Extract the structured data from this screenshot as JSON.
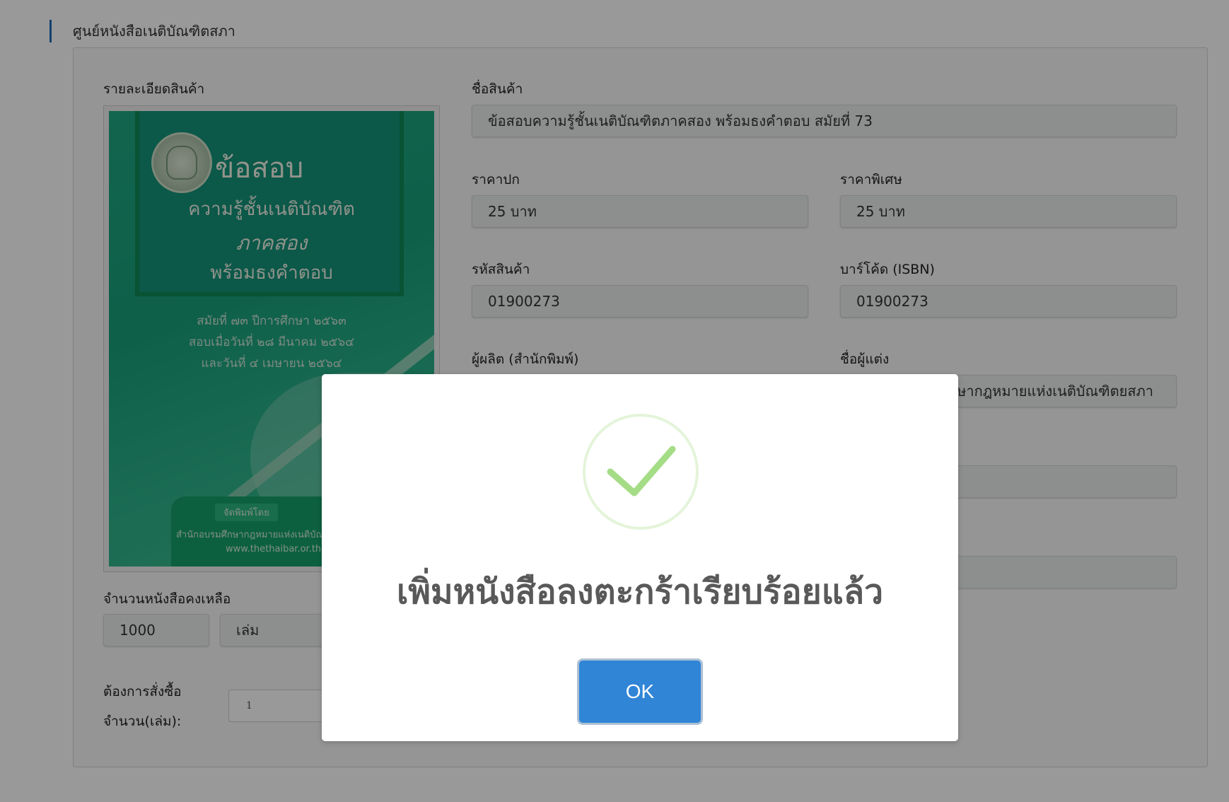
{
  "section": {
    "title": "ศูนย์หนังสือเนติบัณฑิตสภา"
  },
  "product": {
    "details_label": "รายละเอียดสินค้า",
    "name_label": "ชื่อสินค้า",
    "name_value": "ข้อสอบความรู้ชั้นเนติบัณฑิตภาคสอง พร้อมธงคำตอบ สมัยที่ 73",
    "cover_price_label": "ราคาปก",
    "cover_price_value": "25 บาท",
    "special_price_label": "ราคาพิเศษ",
    "special_price_value": "25 บาท",
    "code_label": "รหัสสินค้า",
    "code_value": "01900273",
    "barcode_label": "บาร์โค้ด (ISBN)",
    "barcode_value": "01900273",
    "publisher_label": "ผู้ผลิต (สำนักพิมพ์)",
    "author_label": "ชื่อผู้แต่ง",
    "author_value": "สำนักอบรมศึกษากฎหมายแห่งเนติบัณฑิตยสภา",
    "stock_label": "จำนวนหนังสือคงเหลือ",
    "stock_value": "1000",
    "stock_unit": "เล่ม",
    "order_label_1": "ต้องการสั่งซื้อ",
    "order_label_2": "จำนวน(เล่ม):",
    "order_qty": "1"
  },
  "cover": {
    "title": "ข้อสอบ",
    "line1": "ความรู้ชั้นเนติบัณฑิต",
    "line2": "ภาคสอง",
    "line3": "พร้อมธงคำตอบ",
    "info1": "สมัยที่ ๗๓ ปีการศึกษา ๒๕๖๓",
    "info2": "สอบเมื่อวันที่ ๒๘ มีนาคม ๒๕๖๔",
    "info3": "และวันที่ ๔ เมษายน ๒๕๖๔",
    "badge": "จัดพิมพ์โดย",
    "publisher": "สำนักอบรมศึกษากฎหมายแห่งเนติบัณ",
    "website": "www.thethaibar.or.th"
  },
  "dialog": {
    "icon": "success-check-icon",
    "message": "เพิ่มหนังสือลงตะกร้าเรียบร้อยแล้ว",
    "ok_label": "OK"
  },
  "colors": {
    "accent": "#3085d6",
    "success": "#a5dc86",
    "section_bar": "#1f6fb8"
  }
}
